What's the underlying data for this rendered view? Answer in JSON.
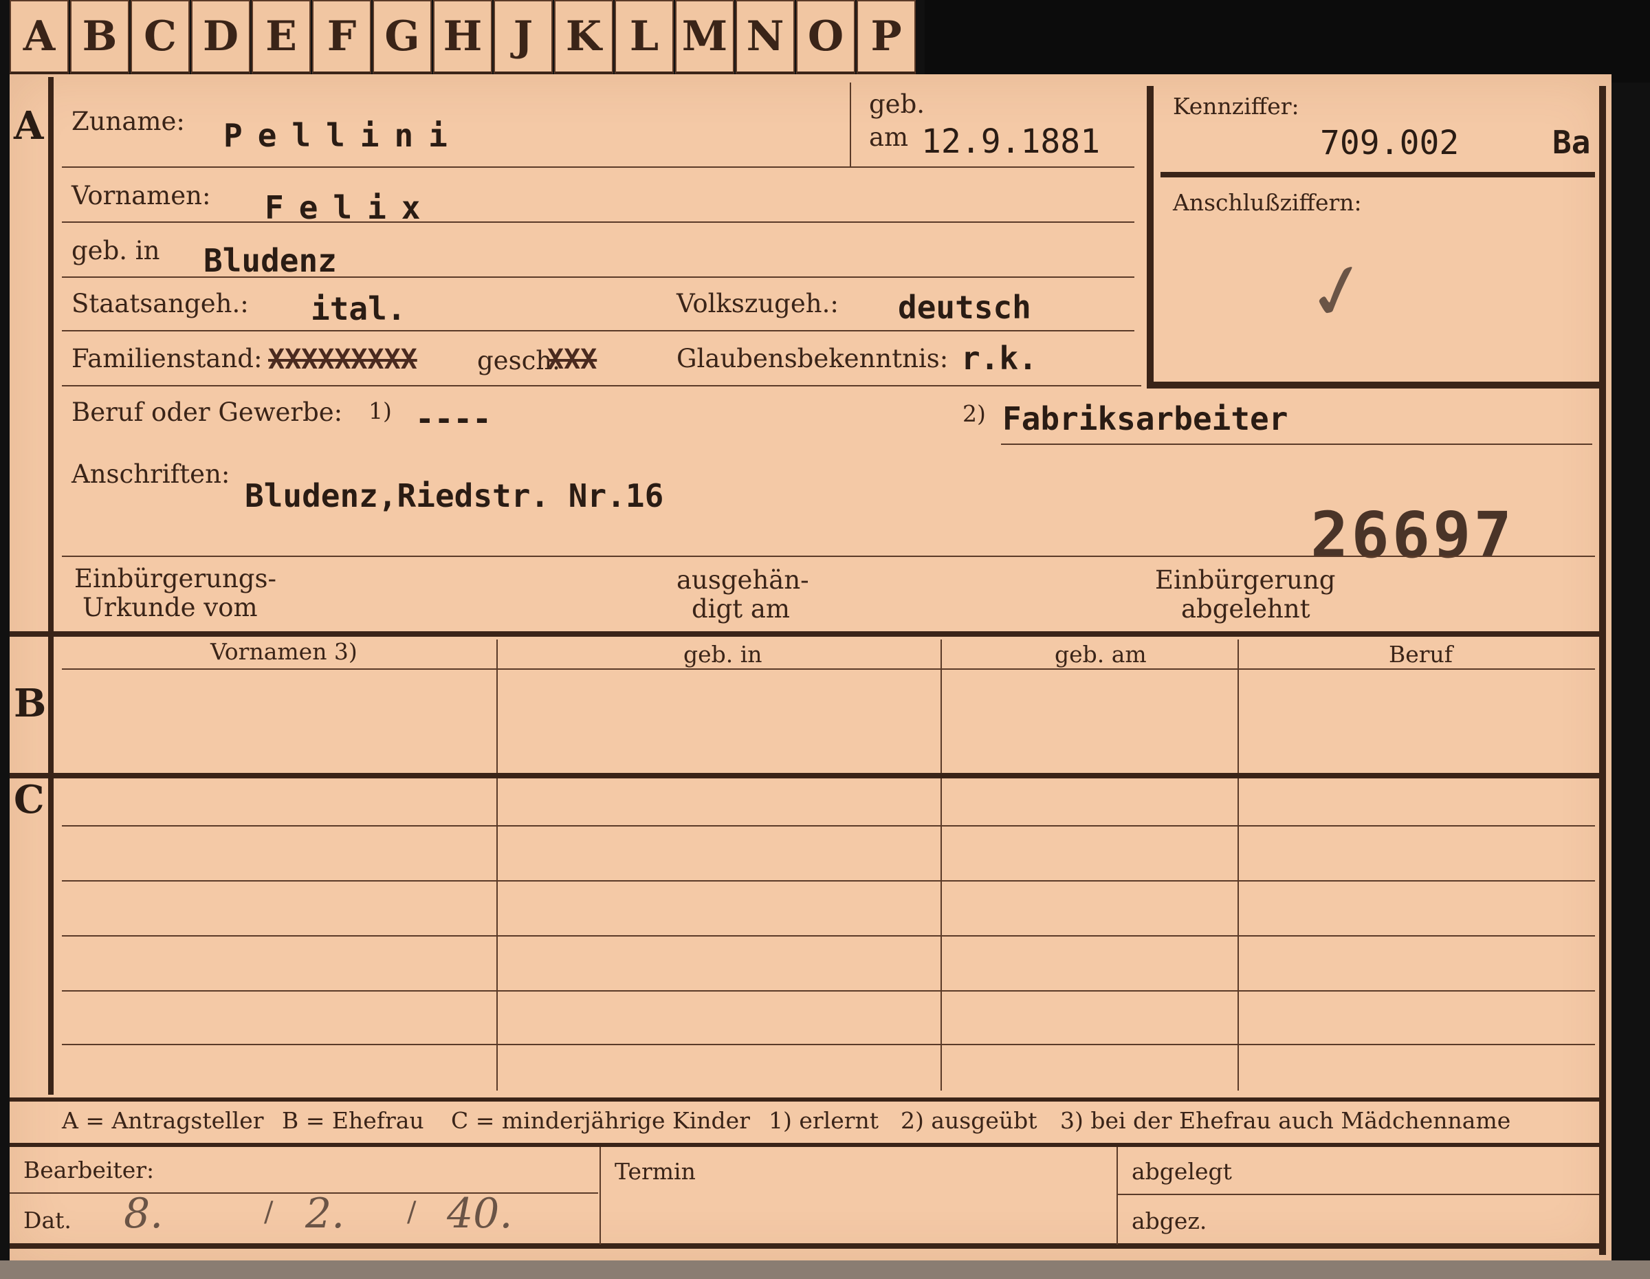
{
  "tabs": [
    "A",
    "B",
    "C",
    "D",
    "E",
    "F",
    "G",
    "H",
    "J",
    "K",
    "L",
    "M",
    "N",
    "O",
    "P"
  ],
  "sections": {
    "a": "A",
    "b": "B",
    "c": "C"
  },
  "header": {
    "surname_label": "Zuname:",
    "surname_value": "Pellini",
    "born_label_1": "geb.",
    "born_label_2": "am",
    "born_value": "12.9.1881",
    "id_label": "Kennziffer:",
    "id_value": "709.002",
    "id_suffix": "Ba",
    "sub_id_label": "Anschlußziffern:",
    "checkmark": "✓"
  },
  "fields": {
    "firstname_label": "Vornamen:",
    "firstname_value": "Felix",
    "birthplace_label": "geb. in",
    "birthplace_value": "Bludenz",
    "citizenship_label": "Staatsangeh.:",
    "citizenship_value": "ital.",
    "ethnicity_label": "Volkszugeh.:",
    "ethnicity_value": "deutsch",
    "marital_label": "Familienstand:",
    "marital_struck": "XXXXXXXXX",
    "marital_value": "gesch.",
    "marital_struck_2": "XXX",
    "religion_label": "Glaubensbekenntnis:",
    "religion_value": "r.k.",
    "occupation_label": "Beruf oder Gewerbe:",
    "occ_note_1": "1)",
    "occupation_learned": "----",
    "occ_note_2": "2)",
    "occupation_practiced": "Fabriksarbeiter",
    "address_label": "Anschriften:",
    "address_value": "Bludenz,Riedstr. Nr.16",
    "stamp_number": "26697",
    "naturalization_label_1": "Einbürgerungs-",
    "naturalization_label_2": "Urkunde vom",
    "handed_label_1": "ausgehän-",
    "handed_label_2": "digt am",
    "rejected_label_1": "Einbürgerung",
    "rejected_label_2": "abgelehnt"
  },
  "table": {
    "columns": [
      "Vornamen 3)",
      "geb. in",
      "geb. am",
      "Beruf"
    ]
  },
  "legend": {
    "a": "A = Antragsteller",
    "b": "B = Ehefrau",
    "c": "C = minderjährige Kinder",
    "n1": "1) erlernt",
    "n2": "2) ausgeübt",
    "n3": "3) bei der Ehefrau auch Mädchenname"
  },
  "footer": {
    "clerk_label": "Bearbeiter:",
    "date_label": "Dat.",
    "date_day": "8.",
    "date_month": "2.",
    "date_year": "40.",
    "date_sep": "/",
    "deadline_label": "Termin",
    "filed_label": "abgelegt",
    "signed_label": "abgez."
  }
}
